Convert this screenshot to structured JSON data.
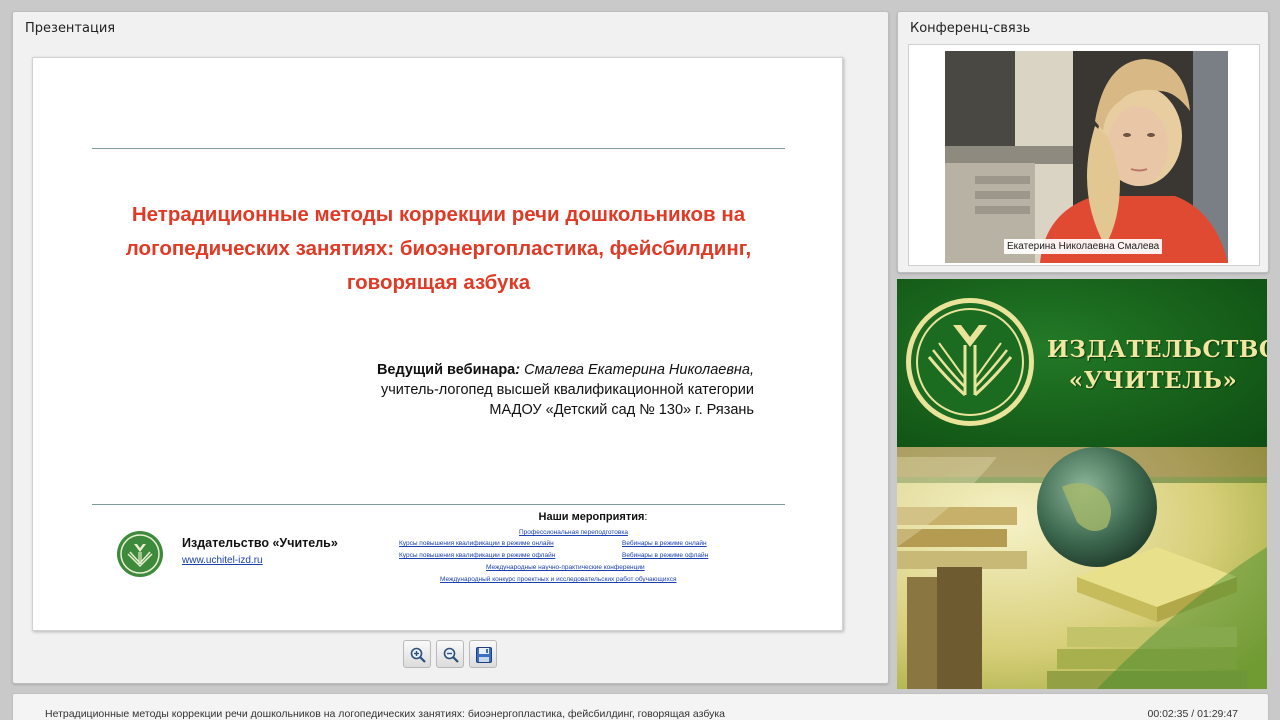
{
  "presentation": {
    "panel_title": "Презентация",
    "slide": {
      "title": "Нетрадиционные методы коррекции речи дошкольников на логопедических занятиях: биоэнергопластика, фейсбилдинг, говорящая азбука",
      "presenter_label": "Ведущий вебинара",
      "presenter_colon": ": ",
      "presenter_name": "Смалева Екатерина Николаевна",
      "presenter_comma": ",",
      "presenter_position": "учитель-логопед высшей квалификационной категории",
      "presenter_org": "МАДОУ «Детский сад № 130» г. Рязань",
      "footer_publisher": "Издательство «Учитель»",
      "footer_url": "www.uchitel-izd.ru",
      "events_heading": "Наши мероприятия",
      "events_heading_colon": ":",
      "events": [
        "Профессиональная переподготовка",
        "Курсы повышения квалификации в режиме онлайн",
        "Вебинары в режиме онлайн",
        "Курсы повышения квалификации в режиме офлайн",
        "Вебинары в режиме офлайн",
        "Международные научно-практические конференции",
        "Международный конкурс проектных и исследовательских работ обучающихся"
      ]
    },
    "toolbar": {
      "zoom_in_icon": "zoom-in-icon",
      "zoom_out_icon": "zoom-out-icon",
      "save_icon": "floppy-disk-icon"
    }
  },
  "conference": {
    "panel_title": "Конференц-связь",
    "speaker_name": "Екатерина Николаевна Смалева"
  },
  "banner": {
    "line1": "ИЗДАТЕЛЬСТВО",
    "line2": "«УЧИТЕЛЬ»"
  },
  "bottom_bar": {
    "title": "Нетрадиционные методы коррекции речи дошкольников на логопедических занятиях: биоэнергопластика, фейсбилдинг, говорящая азбука",
    "elapsed": "00:02:35",
    "separator": " / ",
    "total": "01:29:47"
  },
  "colors": {
    "slide_title": "#e03a26",
    "banner_green": "#145a18",
    "banner_text": "#f2e7a0",
    "link": "#1a3fb0"
  }
}
